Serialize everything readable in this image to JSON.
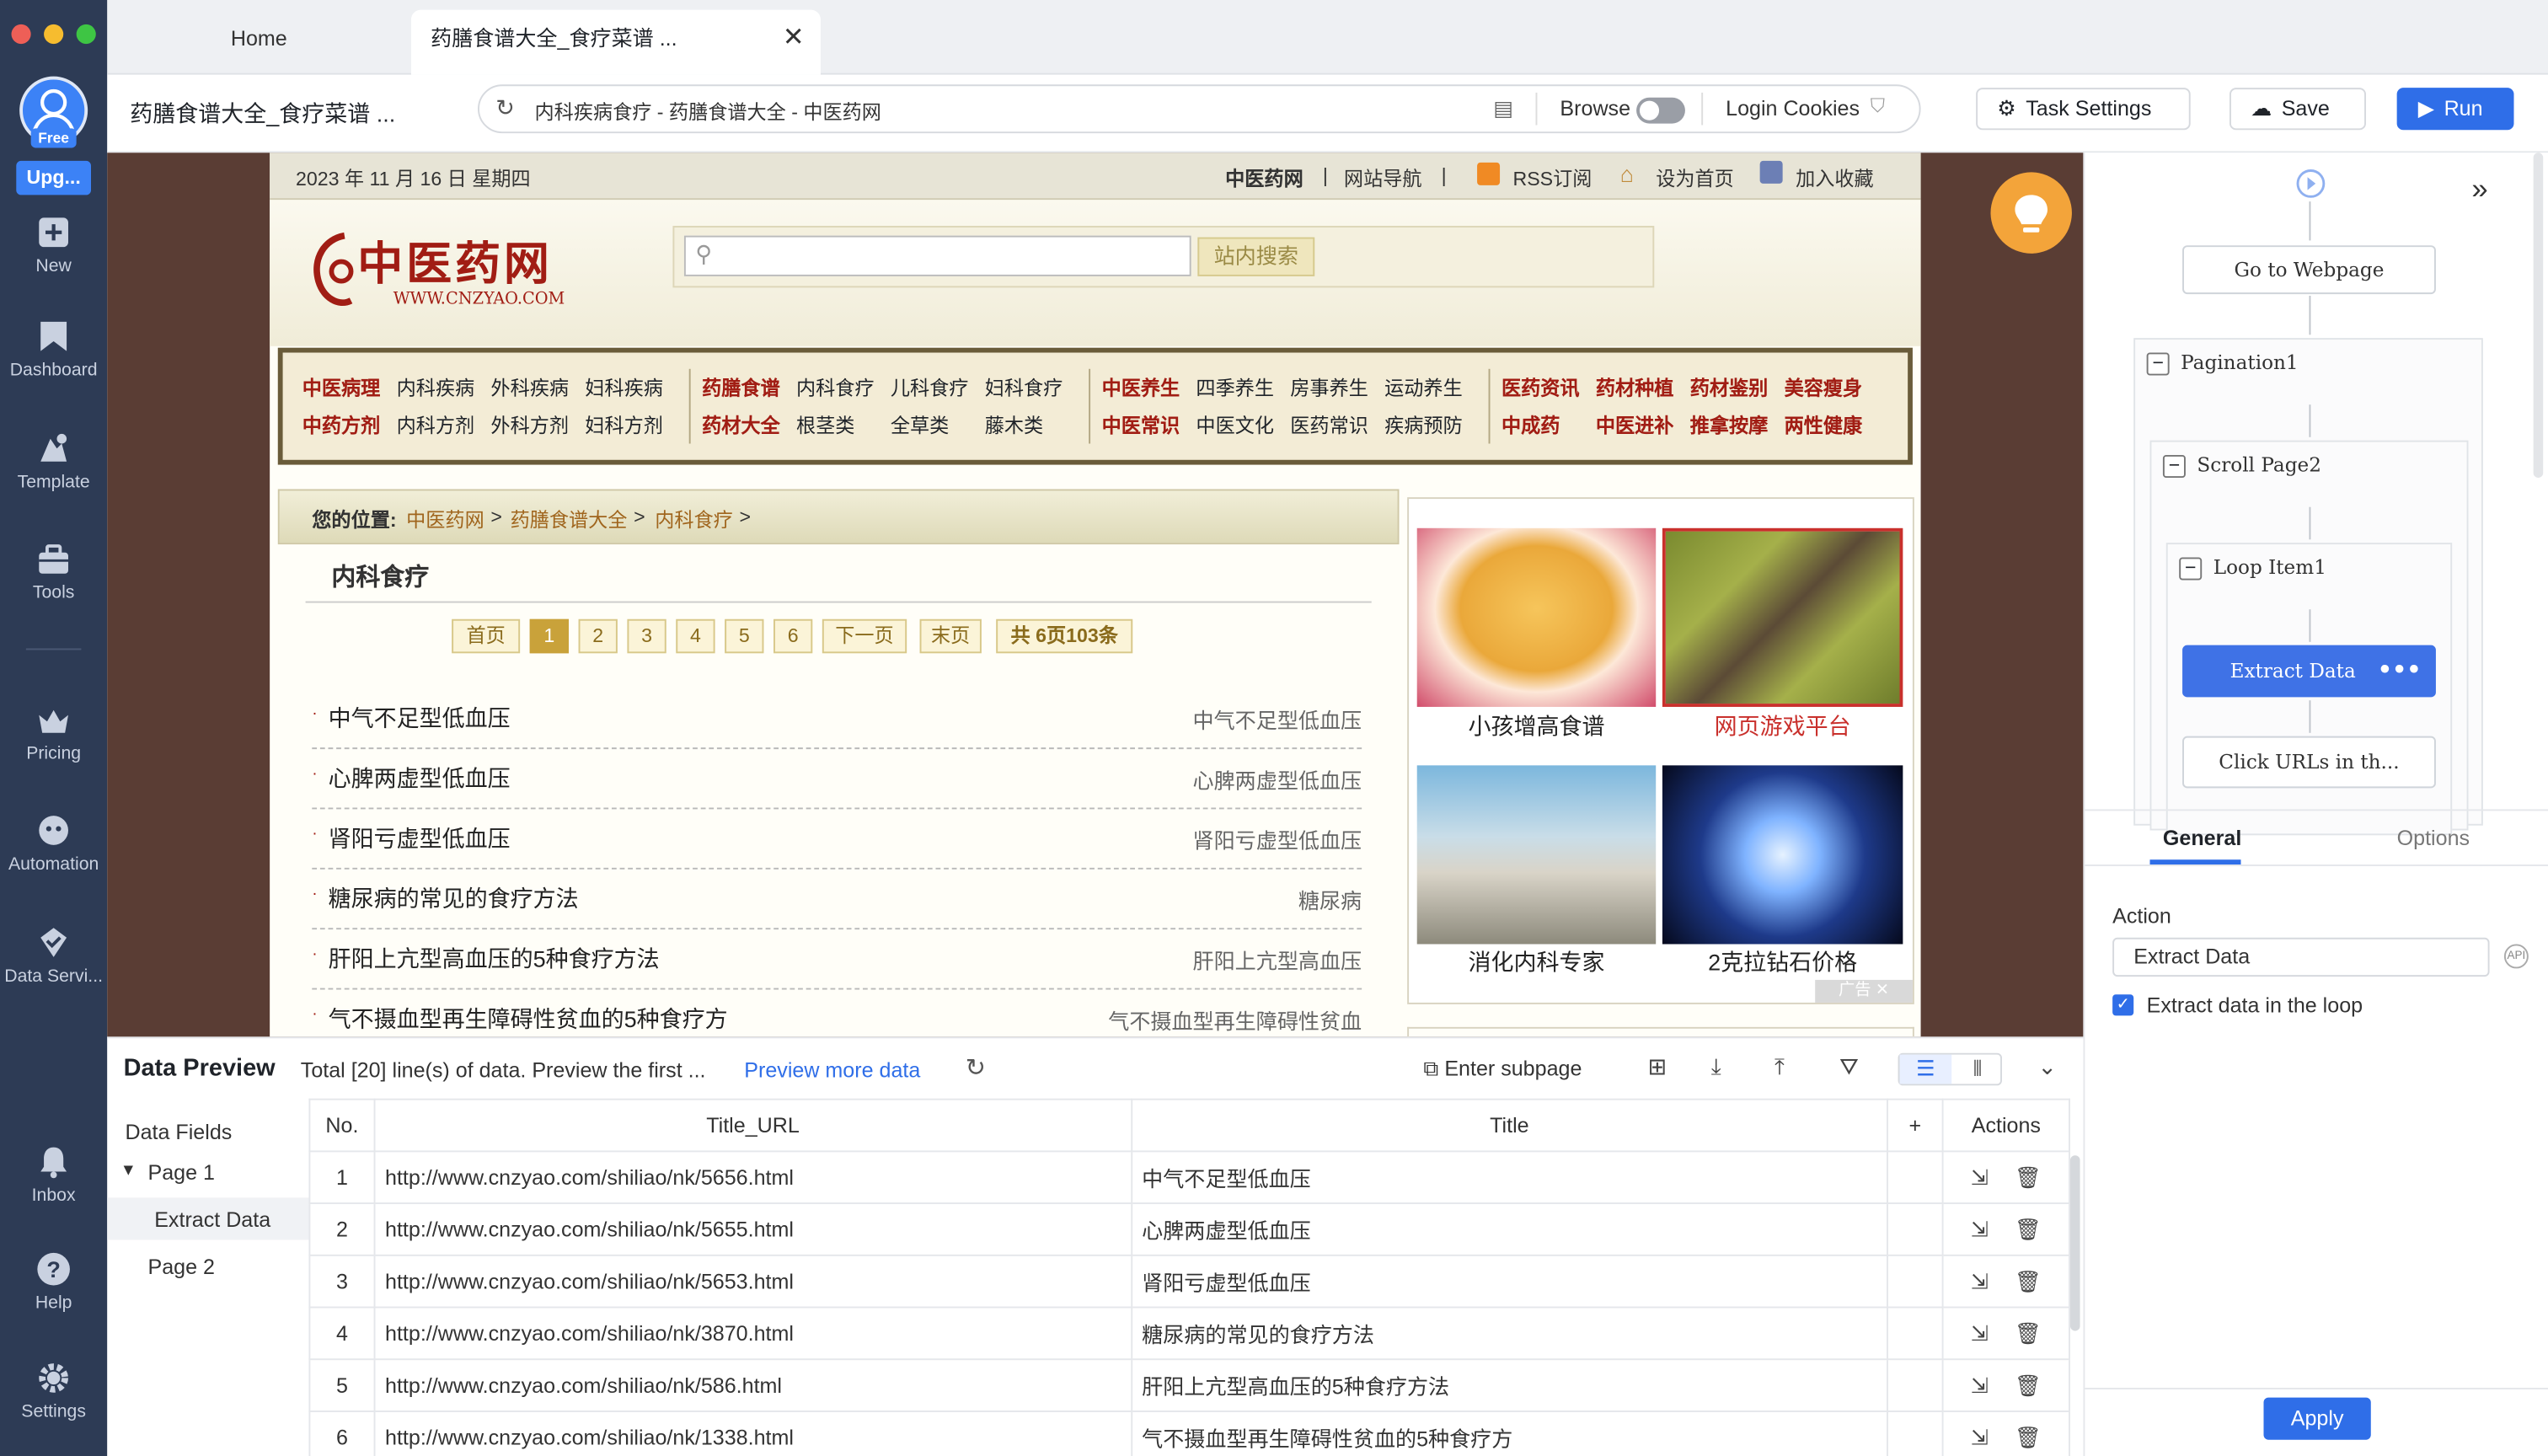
{
  "sidebar": {
    "avatar_badge": "Free",
    "upgrade": "Upg...",
    "items": [
      {
        "label": "New",
        "icon": "plus-icon"
      },
      {
        "label": "Dashboard",
        "icon": "bookmark-icon"
      },
      {
        "label": "Template",
        "icon": "template-icon"
      },
      {
        "label": "Tools",
        "icon": "toolbox-icon"
      },
      {
        "label": "Pricing",
        "icon": "crown-icon"
      },
      {
        "label": "Automation",
        "icon": "robot-icon"
      },
      {
        "label": "Data Servi...",
        "icon": "shield-check-icon"
      },
      {
        "label": "Inbox",
        "icon": "bell-icon"
      },
      {
        "label": "Help",
        "icon": "help-icon"
      },
      {
        "label": "Settings",
        "icon": "gear-icon"
      }
    ]
  },
  "tabs": {
    "home": "Home",
    "active": "药膳食谱大全_食疗菜谱 ..."
  },
  "toolbar": {
    "page_title": "药膳食谱大全_食疗菜谱 ...",
    "url": "内科疾病食疗 - 药膳食谱大全 - 中医药网",
    "browse": "Browse",
    "login_cookies": "Login Cookies",
    "task_settings": "Task Settings",
    "save": "Save",
    "run": "Run"
  },
  "webpage": {
    "date": "2023 年 11 月 16 日   星期四",
    "top_links": [
      "中医药网",
      "|",
      "网站导航",
      "|",
      "RSS订阅",
      "设为首页",
      "加入收藏"
    ],
    "logo_cn": "中医药网",
    "logo_en": "WWW.CNZYAO.COM",
    "search_button": "站内搜索",
    "nav": {
      "row1": [
        "中医病理",
        "内科疾病",
        "外科疾病",
        "妇科疾病",
        "药膳食谱",
        "内科食疗",
        "儿科食疗",
        "妇科食疗",
        "中医养生",
        "四季养生",
        "房事养生",
        "运动养生",
        "医药资讯",
        "药材种植",
        "药材鉴别",
        "美容瘦身"
      ],
      "row2": [
        "中药方剂",
        "内科方剂",
        "外科方剂",
        "妇科方剂",
        "药材大全",
        "根茎类",
        "全草类",
        "藤木类",
        "中医常识",
        "中医文化",
        "医药常识",
        "疾病预防",
        "中成药",
        "中医进补",
        "推拿按摩",
        "两性健康"
      ]
    },
    "breadcrumb_label": "您的位置:",
    "breadcrumb": [
      "中医药网",
      " > ",
      "药膳食谱大全",
      " > ",
      "内科食疗",
      " >"
    ],
    "section_title": "内科食疗",
    "pagination": [
      "首页",
      "1",
      "2",
      "3",
      "4",
      "5",
      "6",
      "下一页",
      "末页",
      "共 6页103条"
    ],
    "list": [
      {
        "title": "中气不足型低血压",
        "tag": "中气不足型低血压"
      },
      {
        "title": "心脾两虚型低血压",
        "tag": "心脾两虚型低血压"
      },
      {
        "title": "肾阳亏虚型低血压",
        "tag": "肾阳亏虚型低血压"
      },
      {
        "title": "糖尿病的常见的食疗方法",
        "tag": "糖尿病"
      },
      {
        "title": "肝阳上亢型高血压的5种食疗方法",
        "tag": "肝阳上亢型高血压"
      },
      {
        "title": "气不摄血型再生障碍性贫血的5种食疗方",
        "tag": "气不摄血型再生障碍性贫血"
      }
    ],
    "ads": [
      "小孩增高食谱",
      "网页游戏平台",
      "消化内科专家",
      "2克拉钻石价格"
    ],
    "ad_label": "广告"
  },
  "flow": {
    "go_to_webpage": "Go to Webpage",
    "pagination": "Pagination1",
    "scroll": "Scroll Page2",
    "loop": "Loop Item1",
    "extract": "Extract Data",
    "click_urls": "Click URLs in th..."
  },
  "rpanel": {
    "tab_general": "General",
    "tab_options": "Options",
    "action_label": "Action",
    "action_value": "Extract Data",
    "checkbox_label": "Extract data in the loop",
    "apply": "Apply"
  },
  "preview": {
    "title": "Data Preview",
    "summary": "Total [20] line(s) of data. Preview the first ...",
    "more": "Preview more data",
    "enter_subpage": "Enter subpage",
    "fields_title": "Data Fields",
    "page1": "Page 1",
    "extract": "Extract Data",
    "page2": "Page 2",
    "headers": {
      "no": "No.",
      "url": "Title_URL",
      "title": "Title",
      "plus": "+",
      "actions": "Actions"
    },
    "rows": [
      {
        "no": "1",
        "url": "http://www.cnzyao.com/shiliao/nk/5656.html",
        "title": "中气不足型低血压"
      },
      {
        "no": "2",
        "url": "http://www.cnzyao.com/shiliao/nk/5655.html",
        "title": "心脾两虚型低血压"
      },
      {
        "no": "3",
        "url": "http://www.cnzyao.com/shiliao/nk/5653.html",
        "title": "肾阳亏虚型低血压"
      },
      {
        "no": "4",
        "url": "http://www.cnzyao.com/shiliao/nk/3870.html",
        "title": "糖尿病的常见的食疗方法"
      },
      {
        "no": "5",
        "url": "http://www.cnzyao.com/shiliao/nk/586.html",
        "title": "肝阳上亢型高血压的5种食疗方法"
      },
      {
        "no": "6",
        "url": "http://www.cnzyao.com/shiliao/nk/1338.html",
        "title": "气不摄血型再生障碍性贫血的5种食疗方"
      }
    ]
  },
  "colors": {
    "accent": "#2f6ee8",
    "sidebar": "#2d3b55",
    "site_red": "#a11d14",
    "bulb": "#f3a43a"
  }
}
